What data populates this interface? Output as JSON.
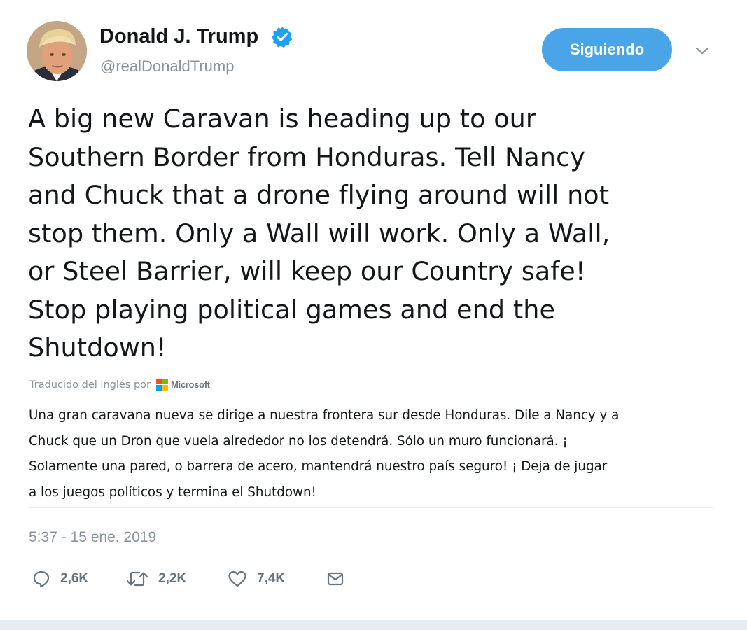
{
  "author": {
    "display_name": "Donald J. Trump",
    "handle": "@realDonaldTrump",
    "verified": true
  },
  "follow_button": {
    "label": "Siguiendo",
    "color": "#4aa4e8"
  },
  "tweet": {
    "text": "A big new Caravan is heading up to our\nSouthern Border from Honduras. Tell Nancy\nand Chuck that a drone flying around will not\nstop them. Only a Wall will work. Only a Wall,\nor Steel Barrier, will keep our Country safe!\nStop playing political games and end the\nShutdown!"
  },
  "translation": {
    "attribution": "Traducido del inglés por",
    "provider": "Microsoft",
    "text": "Una gran caravana nueva se dirige a nuestra frontera sur desde Honduras. Dile a Nancy y a\nChuck que un Dron que vuela alrededor no los detendrá. Sólo un muro funcionará. ¡\nSolamente una pared, o barrera de acero, mantendrá nuestro país seguro! ¡ Deja de jugar\na los juegos políticos y termina el Shutdown!"
  },
  "timestamp": "5:37 - 15 ene. 2019",
  "actions": {
    "replies": "2,6K",
    "retweets": "2,2K",
    "likes": "7,4K"
  },
  "icons": {
    "verified": "verified-badge-icon",
    "caret": "chevron-down-icon",
    "reply": "reply-bubble-icon",
    "retweet": "retweet-arrows-icon",
    "like": "heart-icon",
    "dm": "envelope-icon"
  },
  "colors": {
    "verified": "#1da1f2",
    "secondary_text": "#8a949d",
    "action_gray": "#66757f",
    "divider": "#e6ecf0"
  }
}
